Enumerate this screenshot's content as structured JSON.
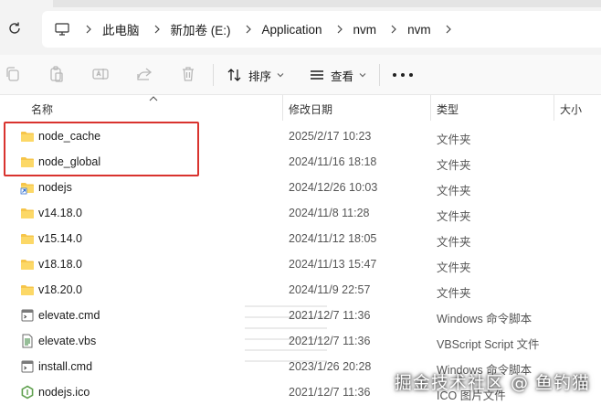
{
  "address": {
    "segments": [
      "此电脑",
      "新加卷 (E:)",
      "Application",
      "nvm",
      "nvm"
    ]
  },
  "toolbar": {
    "sort_label": "排序",
    "view_label": "查看"
  },
  "columns": {
    "name": "名称",
    "date": "修改日期",
    "type": "类型",
    "size": "大小"
  },
  "files": [
    {
      "name": "node_cache",
      "date": "2025/2/17 10:23",
      "type": "文件夹",
      "icon": "folder-icon"
    },
    {
      "name": "node_global",
      "date": "2024/11/16 18:18",
      "type": "文件夹",
      "icon": "folder-icon"
    },
    {
      "name": "nodejs",
      "date": "2024/12/26 10:03",
      "type": "文件夹",
      "icon": "folder-shortcut-icon"
    },
    {
      "name": "v14.18.0",
      "date": "2024/11/8 11:28",
      "type": "文件夹",
      "icon": "folder-icon"
    },
    {
      "name": "v15.14.0",
      "date": "2024/11/12 18:05",
      "type": "文件夹",
      "icon": "folder-icon"
    },
    {
      "name": "v18.18.0",
      "date": "2024/11/13 15:47",
      "type": "文件夹",
      "icon": "folder-icon"
    },
    {
      "name": "v18.20.0",
      "date": "2024/11/9 22:57",
      "type": "文件夹",
      "icon": "folder-icon"
    },
    {
      "name": "elevate.cmd",
      "date": "2021/12/7 11:36",
      "type": "Windows 命令脚本",
      "icon": "cmd-file-icon"
    },
    {
      "name": "elevate.vbs",
      "date": "2021/12/7 11:36",
      "type": "VBScript Script 文件",
      "icon": "vbs-file-icon"
    },
    {
      "name": "install.cmd",
      "date": "2023/1/26 20:28",
      "type": "Windows 命令脚本",
      "icon": "cmd-file-icon"
    },
    {
      "name": "nodejs.ico",
      "date": "2021/12/7 11:36",
      "type": "ICO 图片文件",
      "icon": "nodejs-ico-icon"
    }
  ],
  "watermark": "掘金技术社区 @ 鱼钓猫",
  "colors": {
    "highlight": "#d9332e",
    "folder": "#f6c54a",
    "nodejs": "#5fa04e"
  }
}
